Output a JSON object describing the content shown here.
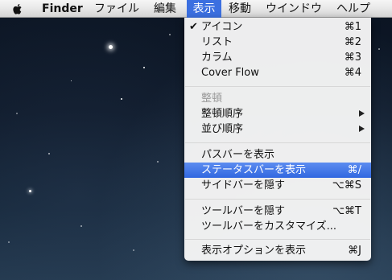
{
  "menubar": {
    "app": "Finder",
    "items": [
      "ファイル",
      "編集",
      "表示",
      "移動",
      "ウインドウ",
      "ヘルプ"
    ]
  },
  "menu": {
    "view_options": [
      {
        "label": "アイコン",
        "shortcut": "⌘1",
        "checked": "✔"
      },
      {
        "label": "リスト",
        "shortcut": "⌘2"
      },
      {
        "label": "カラム",
        "shortcut": "⌘3"
      },
      {
        "label": "Cover Flow",
        "shortcut": "⌘4"
      }
    ],
    "arrange": [
      {
        "label": "整頓"
      },
      {
        "label": "整頓順序"
      },
      {
        "label": "並び順序"
      }
    ],
    "bars": [
      {
        "label": "パスバーを表示"
      },
      {
        "label": "ステータスバーを表示",
        "shortcut": "⌘/"
      },
      {
        "label": "サイドバーを隠す",
        "shortcut": "⌥⌘S"
      }
    ],
    "toolbar": [
      {
        "label": "ツールバーを隠す",
        "shortcut": "⌥⌘T"
      },
      {
        "label": "ツールバーをカスタマイズ..."
      }
    ],
    "options": [
      {
        "label": "表示オプションを表示",
        "shortcut": "⌘J"
      }
    ]
  },
  "colors": {
    "highlight": "#3167e0",
    "menubar_selected": "#3b6fe0",
    "disabled_text": "#9a9a9a"
  },
  "icons": {
    "menubar_logo": "apple-logo-icon",
    "checkmark": "checkmark-icon",
    "submenu": "submenu-arrow-icon"
  }
}
